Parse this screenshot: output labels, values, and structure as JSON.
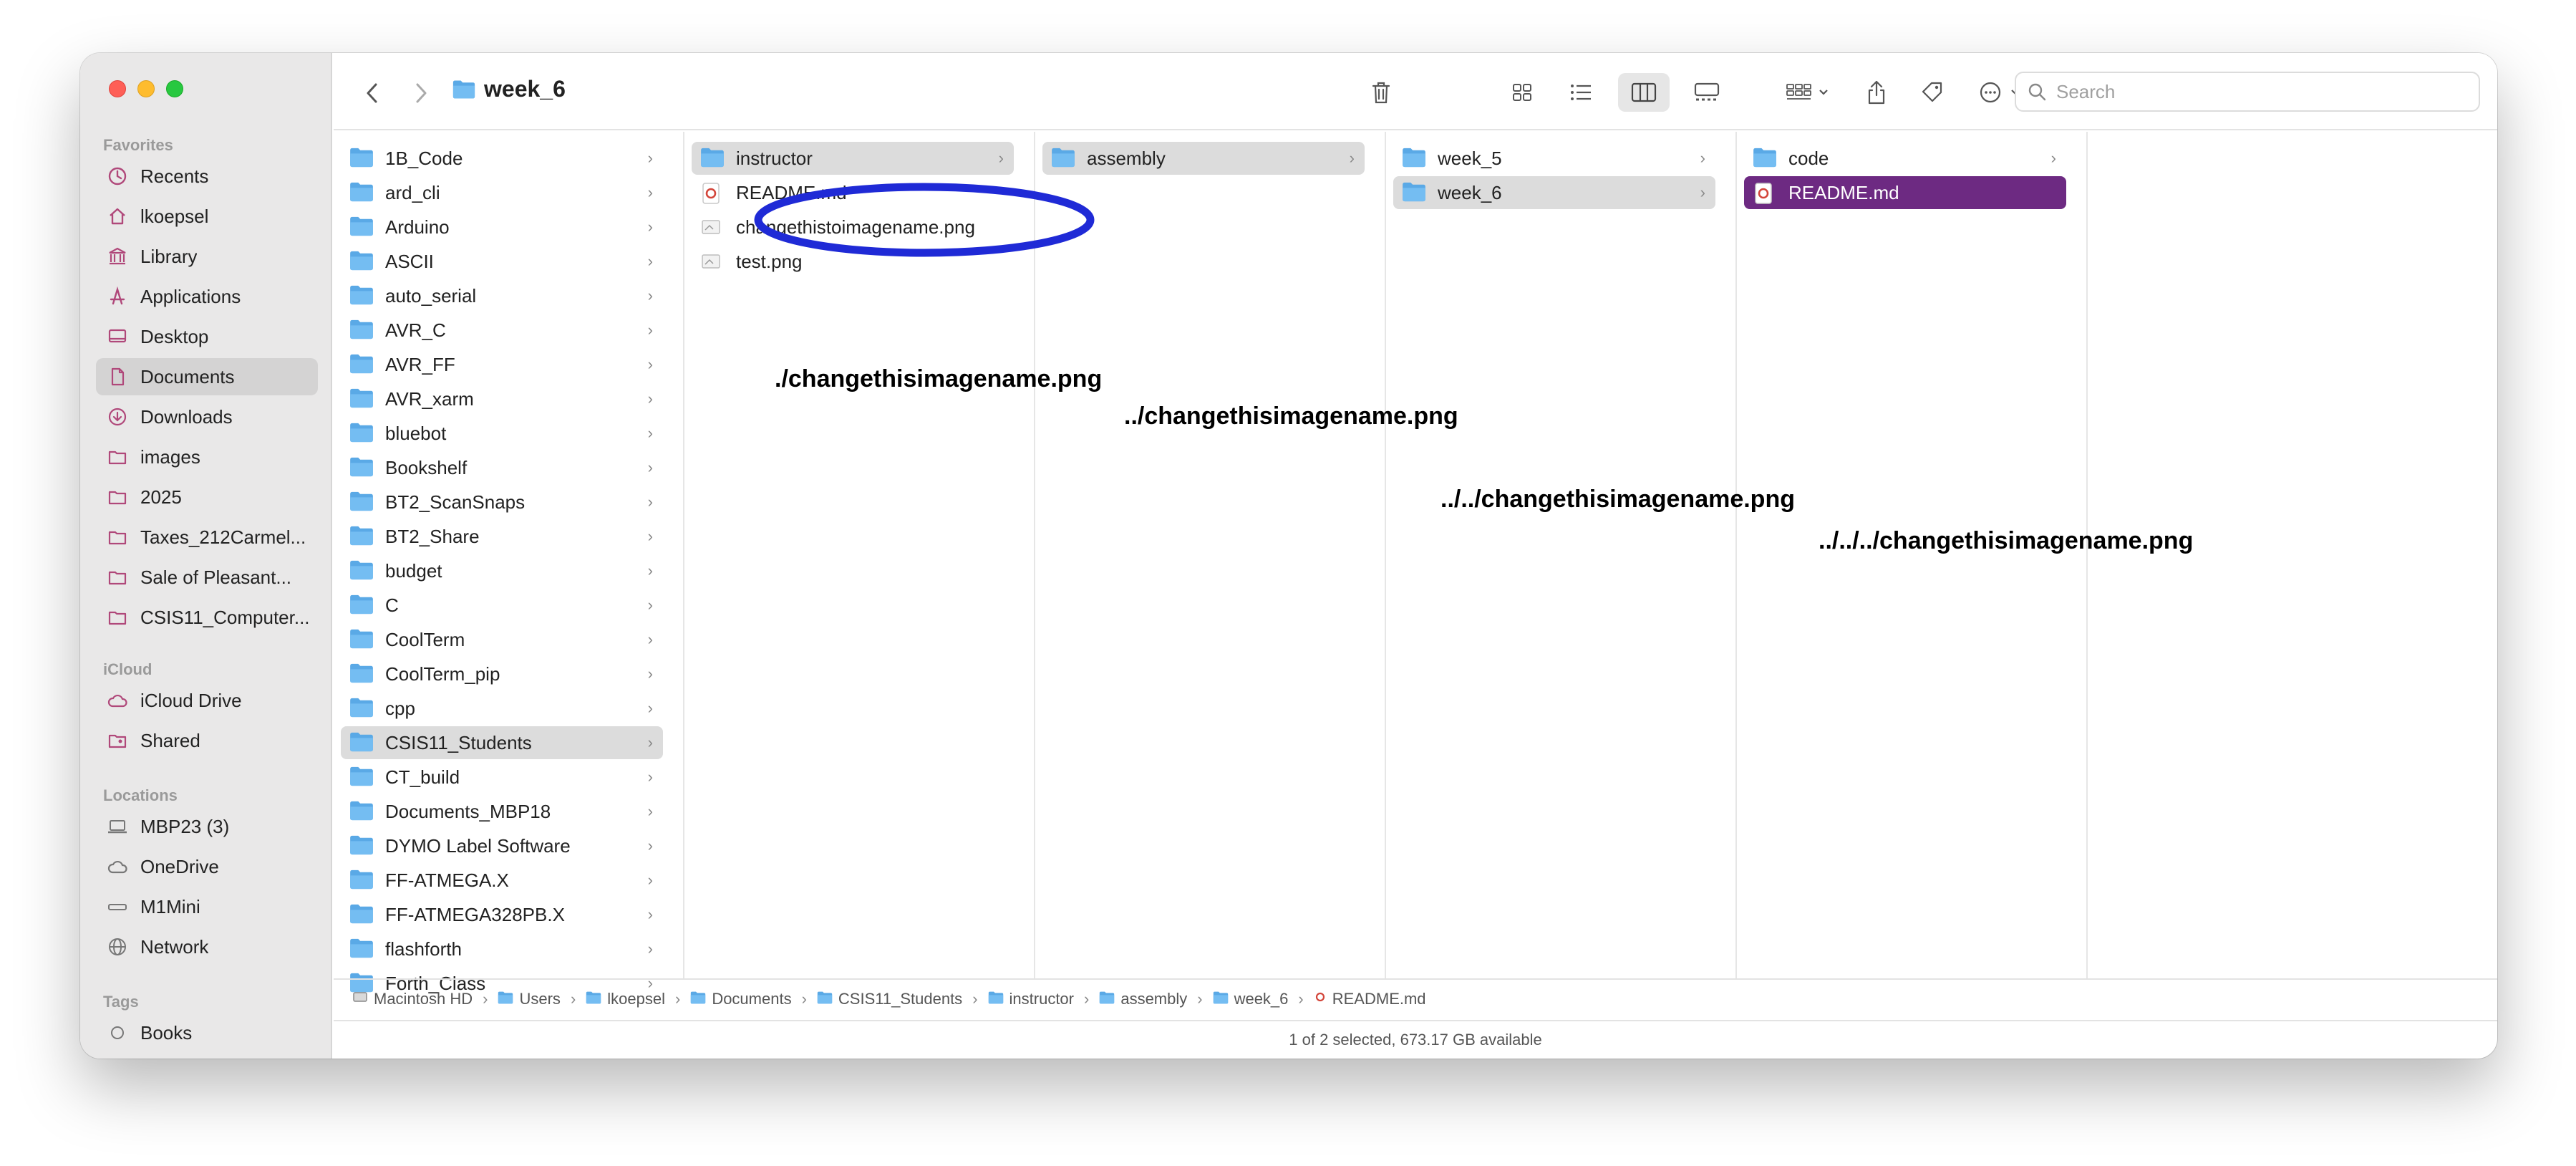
{
  "window": {
    "title": "week_6"
  },
  "sidebar": {
    "favorites_header": "Favorites",
    "favorites": [
      {
        "label": "Recents",
        "icon": "clock-icon"
      },
      {
        "label": "lkoepsel",
        "icon": "home-icon"
      },
      {
        "label": "Library",
        "icon": "library-icon"
      },
      {
        "label": "Applications",
        "icon": "applications-icon"
      },
      {
        "label": "Desktop",
        "icon": "desktop-icon"
      },
      {
        "label": "Documents",
        "icon": "document-icon",
        "active": true
      },
      {
        "label": "Downloads",
        "icon": "download-icon"
      },
      {
        "label": "images",
        "icon": "folder-icon"
      },
      {
        "label": "2025",
        "icon": "folder-icon"
      },
      {
        "label": "Taxes_212Carmel...",
        "icon": "folder-icon"
      },
      {
        "label": "Sale of Pleasant...",
        "icon": "folder-icon"
      },
      {
        "label": "CSIS11_Computer...",
        "icon": "folder-icon"
      }
    ],
    "icloud_header": "iCloud",
    "icloud": [
      {
        "label": "iCloud Drive",
        "icon": "cloud-icon"
      },
      {
        "label": "Shared",
        "icon": "shared-folder-icon"
      }
    ],
    "locations_header": "Locations",
    "locations": [
      {
        "label": "MBP23 (3)",
        "icon": "laptop-icon"
      },
      {
        "label": "OneDrive",
        "icon": "cloud-icon"
      },
      {
        "label": "M1Mini",
        "icon": "mini-icon"
      },
      {
        "label": "Network",
        "icon": "globe-icon"
      }
    ],
    "tags_header": "Tags",
    "tags": [
      {
        "label": "Books",
        "icon": "tag-circle-icon"
      }
    ]
  },
  "toolbar": {
    "search_placeholder": "Search"
  },
  "columns": {
    "col1": [
      "1B_Code",
      "ard_cli",
      "Arduino",
      "ASCII",
      "auto_serial",
      "AVR_C",
      "AVR_FF",
      "AVR_xarm",
      "bluebot",
      "Bookshelf",
      "BT2_ScanSnaps",
      "BT2_Share",
      "budget",
      "C",
      "CoolTerm",
      "CoolTerm_pip",
      "cpp",
      "CSIS11_Students",
      "CT_build",
      "Documents_MBP18",
      "DYMO Label Software",
      "FF-ATMEGA.X",
      "FF-ATMEGA328PB.X",
      "flashforth",
      "Forth_Class"
    ],
    "col2": [
      {
        "label": "instructor",
        "type": "folder"
      },
      {
        "label": "README.md",
        "type": "markdown"
      },
      {
        "label": "changethistoimagename.png",
        "type": "image"
      },
      {
        "label": "test.png",
        "type": "image"
      }
    ],
    "col3": [
      {
        "label": "assembly",
        "type": "folder"
      }
    ],
    "col4": [
      {
        "label": "week_5",
        "type": "folder"
      },
      {
        "label": "week_6",
        "type": "folder"
      }
    ],
    "col5": [
      {
        "label": "code",
        "type": "folder"
      },
      {
        "label": "README.md",
        "type": "markdown"
      }
    ]
  },
  "annotations": {
    "a1": "./changethisimagename.png",
    "a2": "../changethisimagename.png",
    "a3": "../../changethisimagename.png",
    "a4": "../../../changethisimagename.png"
  },
  "pathbar": [
    "Macintosh HD",
    "Users",
    "lkoepsel",
    "Documents",
    "CSIS11_Students",
    "instructor",
    "assembly",
    "week_6",
    "README.md"
  ],
  "status": "1 of 2 selected, 673.17 GB available",
  "colors": {
    "selection_purple": "#6d2a82",
    "annotation_circle": "#1f2ad6",
    "folder_blue": "#6cb6ee"
  }
}
